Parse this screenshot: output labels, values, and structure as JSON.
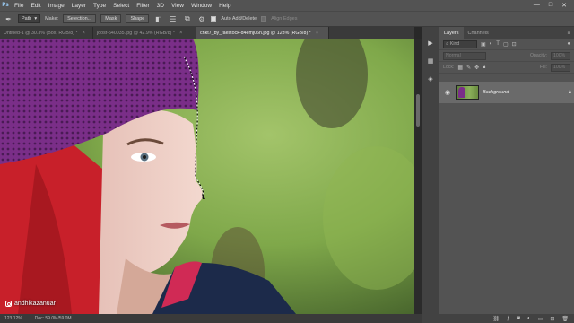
{
  "app": {
    "logo": "Ps"
  },
  "menu": [
    "File",
    "Edit",
    "Image",
    "Layer",
    "Type",
    "Select",
    "Filter",
    "3D",
    "View",
    "Window",
    "Help"
  ],
  "window_controls": [
    "—",
    "□",
    "✕"
  ],
  "options_bar": {
    "mode_value": "Path",
    "make_label": "Make:",
    "selection_button": "Selection...",
    "mask_button": "Mask",
    "shape_button": "Shape",
    "auto_add_delete_label": "Auto Add/Delete",
    "align_edges_label": "Align Edges"
  },
  "tabs": [
    {
      "label": "Untitled-1 @ 30.3% (Box, RGB/8) *",
      "active": false
    },
    {
      "label": "joosf-540035.jpg @ 42.9% (RGB/8) *",
      "active": false
    },
    {
      "label": "cnkt7_by_faestock-d4emj06n.jpg @ 123% (RGB/8) *",
      "active": true
    }
  ],
  "status": {
    "zoom": "123.12%",
    "doc": "Doc: 59.0M/59.0M"
  },
  "watermark": {
    "handle": "andhikazanuar"
  },
  "panel": {
    "tabs": [
      {
        "label": "Layers",
        "active": true
      },
      {
        "label": "Channels",
        "active": false
      }
    ],
    "search_placeholder": "Kind",
    "blend_mode": "Normal",
    "opacity_label": "Opacity:",
    "opacity_value": "100%",
    "lock_label": "Lock:",
    "fill_label": "Fill:",
    "fill_value": "100%",
    "layer": {
      "name": "Background"
    }
  },
  "colors": {
    "panel_bg": "#535353",
    "canvas_bg": "#282828",
    "hat": "#7a2e88",
    "hair": "#c8202a",
    "background_green": "#7fa84a"
  }
}
